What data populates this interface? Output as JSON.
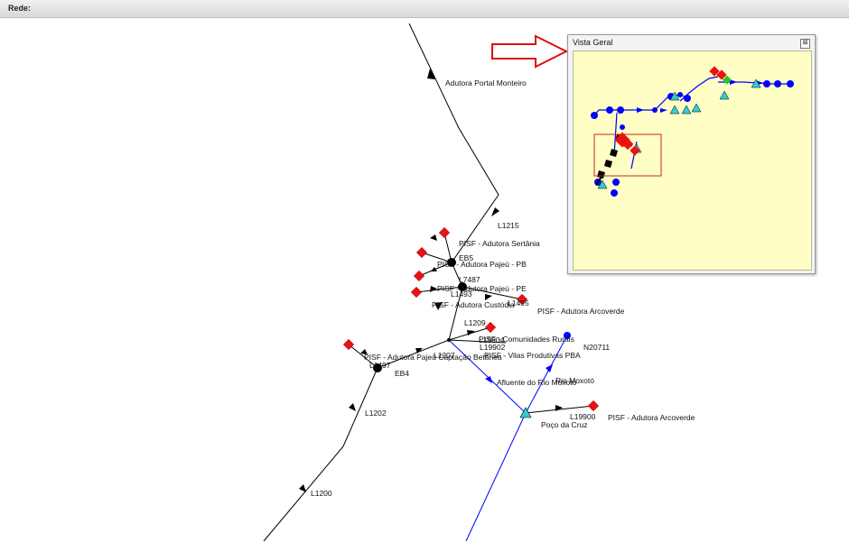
{
  "panel": {
    "title": "Rede:"
  },
  "overview": {
    "title": "Vista Geral",
    "close_glyph": "⊠",
    "background": "#fefec5",
    "viewport_color": "#cc2222"
  },
  "colors": {
    "pipe_black": "#000000",
    "pipe_blue": "#0000ff",
    "reservoir_red": "#ff0000",
    "tank_cyan": "#33cccc",
    "junction_blue": "#0000ff",
    "callout_arrow": "#dd1111"
  },
  "labels": [
    "Adutora Portal Monteiro",
    "L1215",
    "PISF - Adutora Sertânia",
    "PISF - Adutora Pajeú - PB",
    "L7487",
    "PISF - Adutora Pajeú - PE",
    "PISF - Adutora Custódia",
    "L1493",
    "PISF - Adutora Arcoverde",
    "L1209",
    "PISF - Comunidades Rurais",
    "L19902",
    "PISF - Vilas Produtivas PBA",
    "N20711",
    "PISF - Adutora Pajeú Captação Betânea",
    "EB4",
    "Afluente do Rio Moxotó",
    "Rio Moxotó",
    "L1202",
    "L19900",
    "PISF - Adutora Arcoverde",
    "Poço da Cruz",
    "L1200",
    "EB5",
    "L19904",
    "L1207",
    "L1497",
    "L1495"
  ]
}
